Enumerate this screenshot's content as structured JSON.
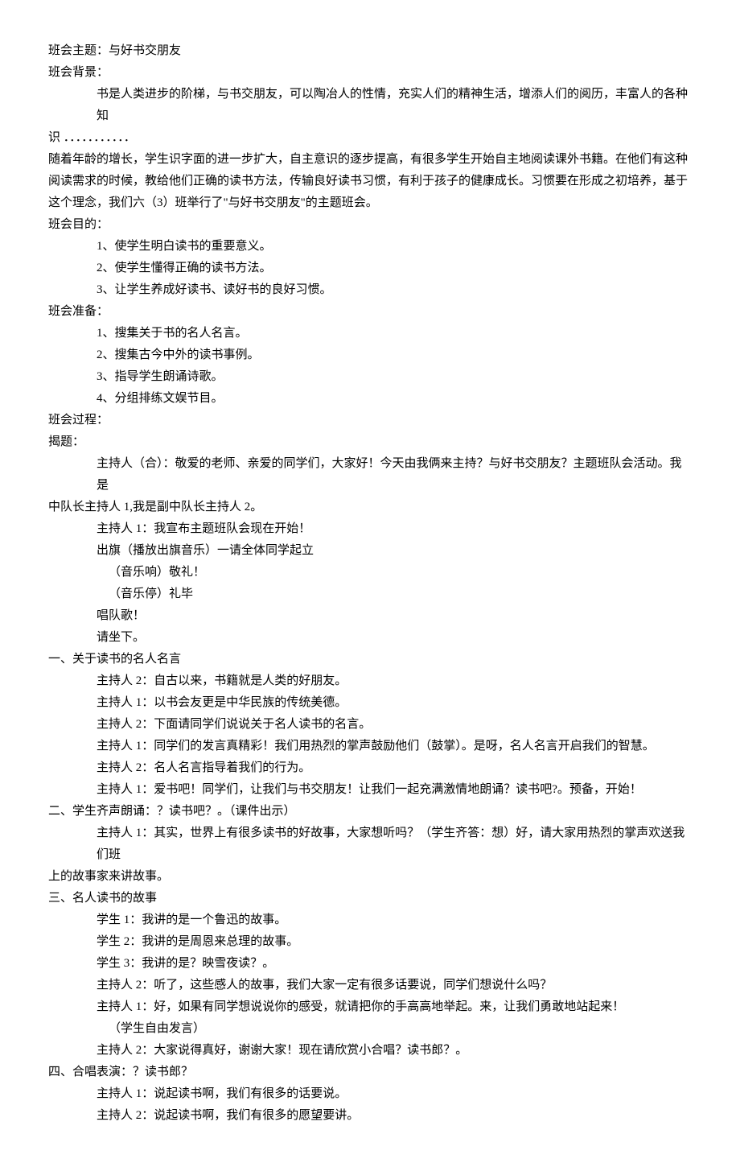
{
  "lines": [
    {
      "cls": "line",
      "text": "班会主题：与好书交朋友"
    },
    {
      "cls": "line",
      "text": "班会背景："
    },
    {
      "cls": "line indent2",
      "text": "书是人类进步的阶梯，与书交朋友，可以陶冶人的性情，充实人们的精神生活，增添人们的阅历，丰富人的各种知"
    },
    {
      "cls": "line",
      "text": "识 ．．．．．．．．．．．"
    },
    {
      "cls": "line",
      "text": "  随着年龄的增长，学生识字面的进一步扩大，自主意识的逐步提高，有很多学生开始自主地阅读课外书籍。在他们有这种阅读需求的时候，教给他们正确的读书方法，传输良好读书习惯，有利于孩子的健康成长。习惯要在形成之初培养，基于这个理念，我们六（3）班举行了\"与好书交朋友\"的主题班会。"
    },
    {
      "cls": "line",
      "text": "班会目的："
    },
    {
      "cls": "line indent2",
      "text": "1、使学生明白读书的重要意义。"
    },
    {
      "cls": "line indent2",
      "text": "2、使学生懂得正确的读书方法。"
    },
    {
      "cls": "line indent2",
      "text": "3、让学生养成好读书、读好书的良好习惯。"
    },
    {
      "cls": "line",
      "text": "班会准备："
    },
    {
      "cls": "line indent2",
      "text": "1、搜集关于书的名人名言。"
    },
    {
      "cls": "line indent2",
      "text": "2、搜集古今中外的读书事例。"
    },
    {
      "cls": "line indent2",
      "text": "3、指导学生朗诵诗歌。"
    },
    {
      "cls": "line indent2",
      "text": "4、分组排练文娱节目。"
    },
    {
      "cls": "line",
      "text": "班会过程："
    },
    {
      "cls": "line",
      "text": "揭题："
    },
    {
      "cls": "line indent2",
      "text": "主持人（合）：敬爱的老师、亲爱的同学们，大家好！今天由我俩来主持？与好书交朋友？主题班队会活动。我是"
    },
    {
      "cls": "line",
      "text": "中队长主持人 1,我是副中队长主持人 2。"
    },
    {
      "cls": "line indent2",
      "text": "主持人 1：我宣布主题班队会现在开始！"
    },
    {
      "cls": "line indent2",
      "text": "出旗（播放出旗音乐）一请全体同学起立"
    },
    {
      "cls": "line indent3",
      "text": "（音乐响）敬礼！"
    },
    {
      "cls": "line indent3",
      "text": "（音乐停）礼毕"
    },
    {
      "cls": "line indent2",
      "text": "唱队歌！"
    },
    {
      "cls": "line indent2",
      "text": "请坐下。"
    },
    {
      "cls": "line",
      "text": "一、关于读书的名人名言"
    },
    {
      "cls": "line indent2",
      "text": "主持人 2：自古以来，书籍就是人类的好朋友。"
    },
    {
      "cls": "line indent2",
      "text": "主持人 1：以书会友更是中华民族的传统美德。"
    },
    {
      "cls": "line indent2",
      "text": "主持人 2：下面请同学们说说关于名人读书的名言。"
    },
    {
      "cls": "line indent2",
      "text": "主持人 1：同学们的发言真精彩！我们用热烈的掌声鼓励他们（鼓掌）。是呀，名人名言开启我们的智慧。"
    },
    {
      "cls": "line indent2",
      "text": "主持人 2：名人名言指导着我们的行为。"
    },
    {
      "cls": "line indent2",
      "text": "主持人 1：爱书吧！同学们，让我们与书交朋友！让我们一起充满激情地朗诵？读书吧?。预备，开始！"
    },
    {
      "cls": "line",
      "text": "二、学生齐声朗诵：？读书吧？。（课件出示）"
    },
    {
      "cls": "line indent2",
      "text": "主持人 1：其实，世界上有很多读书的好故事，大家想听吗？（学生齐答：想）好，请大家用热烈的掌声欢送我们班"
    },
    {
      "cls": "line",
      "text": "上的故事家来讲故事。"
    },
    {
      "cls": "line",
      "text": "三、名人读书的故事"
    },
    {
      "cls": "line indent2",
      "text": "学生 1：我讲的是一个鲁迅的故事。"
    },
    {
      "cls": "line indent2",
      "text": "学生 2：我讲的是周恩来总理的故事。"
    },
    {
      "cls": "line indent2",
      "text": "学生 3：我讲的是？映雪夜读？。"
    },
    {
      "cls": "line indent2",
      "text": "主持人 2：听了，这些感人的故事，我们大家一定有很多话要说，同学们想说什么吗？"
    },
    {
      "cls": "line indent2",
      "text": "主持人 1：好，如果有同学想说说你的感受，就请把你的手高高地举起。来，让我们勇敢地站起来！"
    },
    {
      "cls": "line indent3",
      "text": "（学生自由发言）"
    },
    {
      "cls": "line indent2",
      "text": "主持人 2：大家说得真好，谢谢大家！现在请欣赏小合唱？读书郎？。"
    },
    {
      "cls": "line",
      "text": "四、合唱表演：？读书郎？"
    },
    {
      "cls": "line indent2",
      "text": "主持人 1：说起读书啊，我们有很多的话要说。"
    },
    {
      "cls": "line indent2",
      "text": "主持人 2：说起读书啊，我们有很多的愿望要讲。"
    }
  ]
}
